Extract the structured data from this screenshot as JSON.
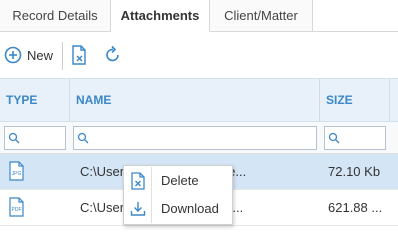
{
  "tabs": [
    {
      "label": "Record Details"
    },
    {
      "label": "Attachments"
    },
    {
      "label": "Client/Matter"
    }
  ],
  "toolbar": {
    "new_label": "New",
    "icons": [
      "add-circle-icon",
      "delete-file-icon",
      "refresh-icon"
    ]
  },
  "table": {
    "columns": [
      "TYPE",
      "NAME",
      "SIZE"
    ],
    "rows": [
      {
        "type": "JPG",
        "name": "C:\\Users\\...\\Desktop\\buchare...",
        "name_visible": "C:\\User          ktop\\buchare...",
        "size": "72.10 Kb"
      },
      {
        "type": "PDF",
        "name": "C:\\Users\\...\\Documents\\all fil...",
        "name_visible": "C:\\User          uments\\all fil...",
        "size": "621.88 ..."
      }
    ]
  },
  "context_menu": {
    "items": [
      {
        "label": "Delete",
        "icon": "delete-file-icon"
      },
      {
        "label": "Download",
        "icon": "download-icon"
      }
    ]
  },
  "colors": {
    "accent": "#3b87c8",
    "header_bg": "#e8f1fa",
    "selected_row": "#d4e6f6"
  }
}
